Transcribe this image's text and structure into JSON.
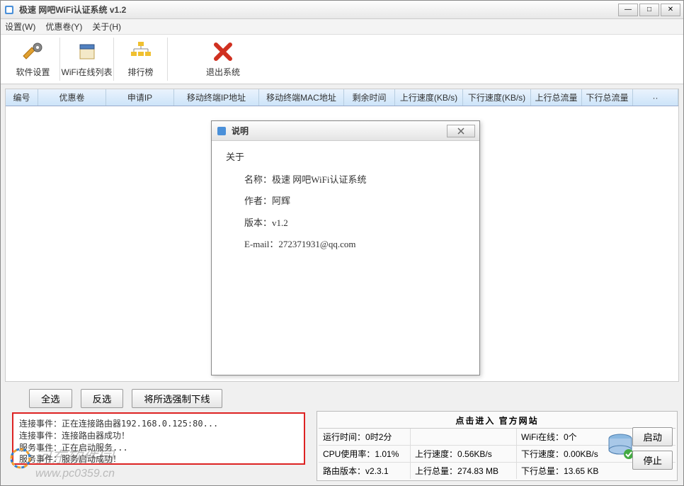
{
  "window": {
    "title": "极速 网吧WiFi认证系统 v1.2",
    "min": "—",
    "max": "□",
    "close": "✕"
  },
  "menu": {
    "settings": "设置(W)",
    "coupon": "优惠卷(Y)",
    "about": "关于(H)"
  },
  "toolbar": {
    "settings": "软件设置",
    "wifi_list": "WiFi在线列表",
    "ranking": "排行榜",
    "exit": "退出系统"
  },
  "columns": {
    "no": "编号",
    "coupon": "优惠卷",
    "apply_ip": "申请IP",
    "mobile_ip": "移动终端IP地址",
    "mobile_mac": "移动终端MAC地址",
    "remain": "剩余时间",
    "up_speed": "上行速度(KB/s)",
    "down_speed": "下行速度(KB/s)",
    "up_total": "上行总流量",
    "down_total": "下行总流量",
    "more": "··"
  },
  "dialog": {
    "title": "说明",
    "section": "关于",
    "name_label": "名称：",
    "name_value": "极速 网吧WiFi认证系统",
    "author_label": "作者：",
    "author_value": "阿辉",
    "version_label": "版本：",
    "version_value": "v1.2",
    "email_label": "E-mail：",
    "email_value": "272371931@qq.com"
  },
  "actions": {
    "select_all": "全选",
    "invert": "反选",
    "force_offline": "将所选强制下线"
  },
  "log": {
    "l1": "连接事件：正在连接路由器192.168.0.125:80...",
    "l2": "连接事件：连接路由器成功！",
    "l3": "服务事件：正在启动服务...",
    "l4": "服务事件：服务启动成功！"
  },
  "footer": {
    "link": "点击进入 官方网站",
    "runtime_label": "运行时间：",
    "runtime_value": "0时2分",
    "wifi_label": "WiFi在线：",
    "wifi_value": "0个",
    "cpu_label": "CPU使用率：",
    "cpu_value": "1.01%",
    "up_speed_label": "上行速度：",
    "up_speed_value": "0.56KB/s",
    "down_speed_label": "下行速度：",
    "down_speed_value": "0.00KB/s",
    "router_ver_label": "路由版本：",
    "router_ver_value": "v2.3.1",
    "up_total_label": "上行总量：",
    "up_total_value": "274.83 MB",
    "down_total_label": "下行总量：",
    "down_total_value": "13.65 KB",
    "start": "启动",
    "stop": "停止"
  },
  "watermark": {
    "cn": "河东软件园",
    "url": "www.pc0359.cn"
  }
}
